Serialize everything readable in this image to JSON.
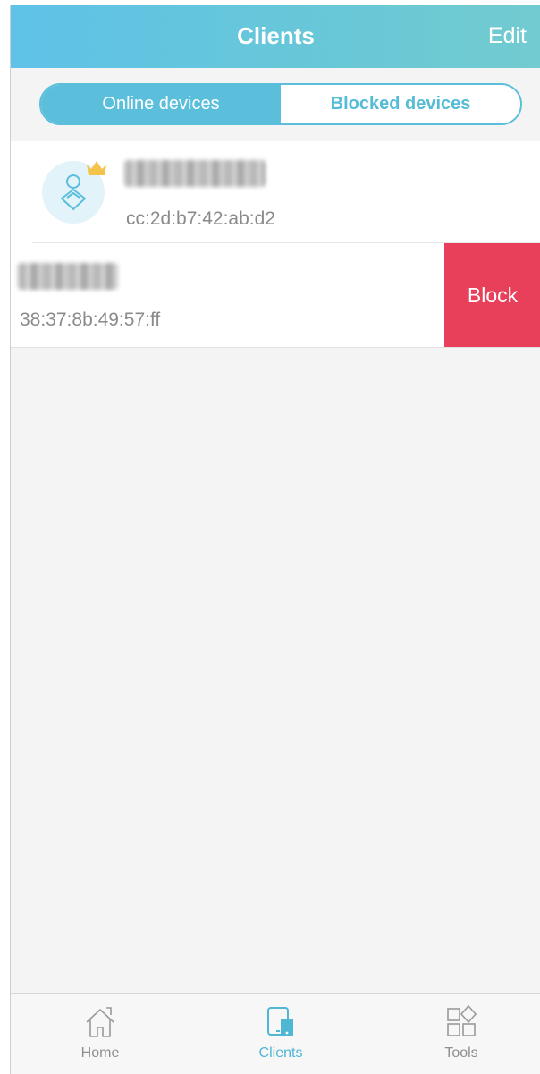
{
  "header": {
    "title": "Clients",
    "edit_label": "Edit"
  },
  "segments": {
    "online_label": "Online devices",
    "blocked_label": "Blocked devices",
    "selected": "online"
  },
  "clients": [
    {
      "name": "",
      "name_blurred": true,
      "mac": "cc:2d:b7:42:ab:d2",
      "owner_crown": true
    },
    {
      "name": "",
      "name_blurred": true,
      "mac": "38:37:8b:49:57:ff",
      "swipe_action": "Block"
    }
  ],
  "tabbar": {
    "items": [
      {
        "label": "Home",
        "icon": "home-icon",
        "active": false
      },
      {
        "label": "Clients",
        "icon": "clients-icon",
        "active": true
      },
      {
        "label": "Tools",
        "icon": "tools-icon",
        "active": false
      }
    ]
  },
  "colors": {
    "accent": "#5bbfdc",
    "block": "#e8405a",
    "crown": "#f5c24a"
  }
}
